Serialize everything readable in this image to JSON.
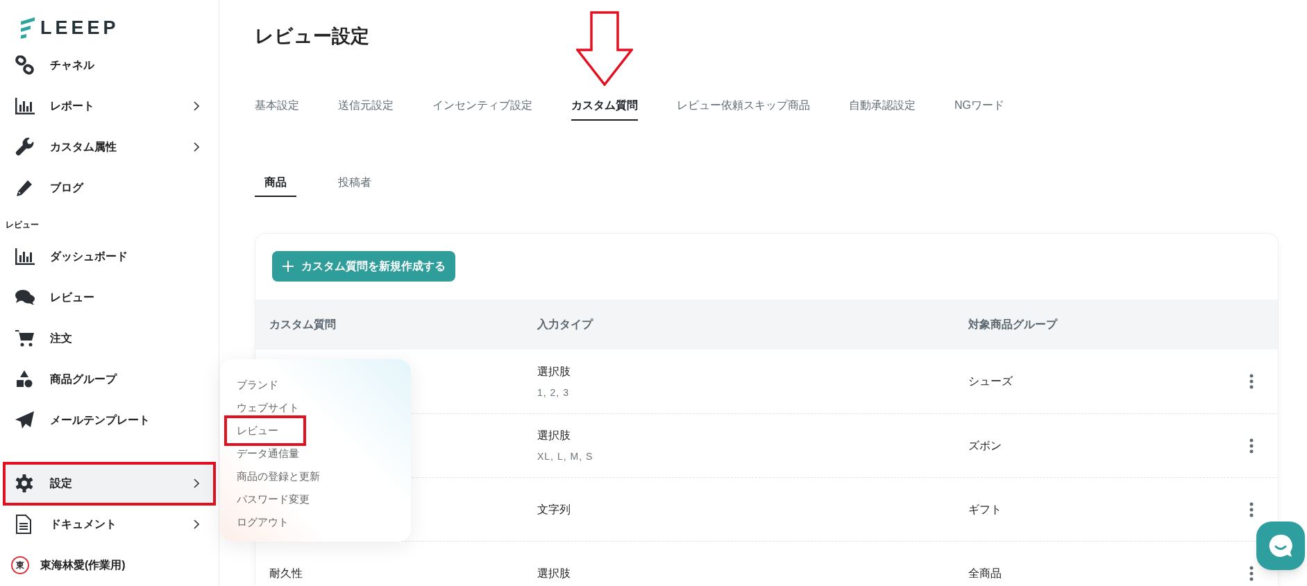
{
  "logo": {
    "text": "LEEEP"
  },
  "sidebar": {
    "items": [
      {
        "kind": "item",
        "label": "チャネル",
        "has_submenu": false,
        "highlighted": false,
        "annotated": false
      },
      {
        "kind": "item",
        "label": "レポート",
        "has_submenu": true,
        "highlighted": false,
        "annotated": false
      },
      {
        "kind": "item",
        "label": "カスタム属性",
        "has_submenu": true,
        "highlighted": false,
        "annotated": false
      },
      {
        "kind": "item",
        "label": "ブログ",
        "has_submenu": false,
        "highlighted": false,
        "annotated": false
      },
      {
        "kind": "section",
        "label": "レビュー"
      },
      {
        "kind": "item",
        "label": "ダッシュボード",
        "has_submenu": false,
        "highlighted": false,
        "annotated": false
      },
      {
        "kind": "item",
        "label": "レビュー",
        "has_submenu": false,
        "highlighted": false,
        "annotated": false
      },
      {
        "kind": "item",
        "label": "注文",
        "has_submenu": false,
        "highlighted": false,
        "annotated": false
      },
      {
        "kind": "item",
        "label": "商品グループ",
        "has_submenu": false,
        "highlighted": false,
        "annotated": false
      },
      {
        "kind": "item",
        "label": "メールテンプレート",
        "has_submenu": false,
        "highlighted": false,
        "annotated": false
      },
      {
        "kind": "item",
        "label": "設定",
        "has_submenu": true,
        "highlighted": true,
        "annotated": true
      },
      {
        "kind": "item",
        "label": "ドキュメント",
        "has_submenu": true,
        "highlighted": false,
        "annotated": false
      },
      {
        "kind": "user",
        "label": "東海林愛(作業用)",
        "avatar_text": "東"
      }
    ]
  },
  "popup_menu": {
    "items": [
      {
        "label": "ブランド",
        "annotated": false
      },
      {
        "label": "ウェブサイト",
        "annotated": false
      },
      {
        "label": "レビュー",
        "annotated": true
      },
      {
        "label": "データ通信量",
        "annotated": false
      },
      {
        "label": "商品の登録と更新",
        "annotated": false
      },
      {
        "label": "パスワード変更",
        "annotated": false
      },
      {
        "label": "ログアウト",
        "annotated": false
      }
    ]
  },
  "page": {
    "title": "レビュー設定"
  },
  "tabs": [
    {
      "label": "基本設定",
      "selected": false,
      "annotated": false
    },
    {
      "label": "送信元設定",
      "selected": false,
      "annotated": false
    },
    {
      "label": "インセンティブ設定",
      "selected": false,
      "annotated": false
    },
    {
      "label": "カスタム質問",
      "selected": true,
      "annotated": true
    },
    {
      "label": "レビュー依頼スキップ商品",
      "selected": false,
      "annotated": false
    },
    {
      "label": "自動承認設定",
      "selected": false,
      "annotated": false
    },
    {
      "label": "NGワード",
      "selected": false,
      "annotated": false
    }
  ],
  "sub_tabs": [
    {
      "label": "商品",
      "selected": true
    },
    {
      "label": "投稿者",
      "selected": false
    }
  ],
  "create_button": {
    "label": "カスタム質問を新規作成する"
  },
  "table": {
    "columns": [
      "カスタム質問",
      "入力タイプ",
      "対象商品グループ"
    ],
    "rows": [
      {
        "input_type": "選択肢",
        "options": "1, 2, 3",
        "target_group": "シューズ"
      },
      {
        "input_type": "選択肢",
        "options": "XL, L, M, S",
        "target_group": "ズボン"
      },
      {
        "input_type": "文字列",
        "target_group": "ギフト"
      },
      {
        "question": "耐久性",
        "input_type": "選択肢",
        "target_group": "全商品"
      }
    ]
  }
}
